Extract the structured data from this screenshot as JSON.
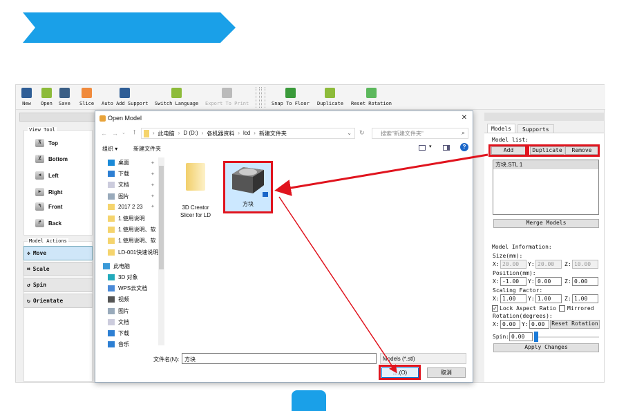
{
  "colors": {
    "accent": "#1aa0e8",
    "highlight": "#e0141e"
  },
  "toolbar": [
    {
      "label": "New",
      "icon": "new-icon",
      "color": "#2f5e96"
    },
    {
      "label": "Open",
      "icon": "open-icon",
      "color": "#8dbb3a"
    },
    {
      "label": "Save",
      "icon": "save-icon",
      "color": "#3b5f86"
    },
    {
      "label": "Slice",
      "icon": "slice-icon",
      "color": "#f08a3c"
    },
    {
      "label": "Auto Add Support",
      "icon": "support-icon",
      "color": "#2f5e96"
    },
    {
      "label": "Switch Language",
      "icon": "language-icon",
      "color": "#8dbb3a"
    },
    {
      "label": "Export To Print",
      "icon": "export-icon",
      "color": "#bbbbbb"
    },
    {
      "label": "Snap To Floor",
      "icon": "snap-floor-icon",
      "color": "#3a9a3a"
    },
    {
      "label": "Duplicate",
      "icon": "duplicate-icon",
      "color": "#8dbb3a"
    },
    {
      "label": "Reset Rotation",
      "icon": "reset-rotation-icon",
      "color": "#5cb85c"
    }
  ],
  "left": {
    "view_title": "View Tool",
    "views": [
      {
        "label": "Top",
        "glyph": "⊼"
      },
      {
        "label": "Bottom",
        "glyph": "⊻"
      },
      {
        "label": "Left",
        "glyph": "◂"
      },
      {
        "label": "Right",
        "glyph": "▸"
      },
      {
        "label": "Front",
        "glyph": "↰"
      },
      {
        "label": "Back",
        "glyph": "↱"
      }
    ],
    "actions_title": "Model Actions",
    "actions": [
      {
        "label": "Move",
        "glyph": "✥"
      },
      {
        "label": "Scale",
        "glyph": "⌗"
      },
      {
        "label": "Spin",
        "glyph": "↺"
      },
      {
        "label": "Orientate",
        "glyph": "↻"
      }
    ]
  },
  "dialog": {
    "title": "Open Model",
    "close": "✕",
    "breadcrumb": [
      "此电脑",
      "D (D:)",
      "各机器资料",
      "lcd",
      "新建文件夹"
    ],
    "search_placeholder": "搜索\"新建文件夹\"",
    "organize": "组织 ▾",
    "new_folder": "新建文件夹",
    "nav": [
      {
        "label": "桌面",
        "icon": "desktop-icon",
        "pinned": true
      },
      {
        "label": "下载",
        "icon": "download-icon",
        "pinned": true
      },
      {
        "label": "文档",
        "icon": "document-icon",
        "pinned": true
      },
      {
        "label": "图片",
        "icon": "pictures-icon",
        "pinned": true
      },
      {
        "label": "2017 2 23",
        "icon": "folder-icon",
        "pinned": true
      },
      {
        "label": "1.使用说明",
        "icon": "folder-icon"
      },
      {
        "label": "1.使用说明、软",
        "icon": "folder-icon"
      },
      {
        "label": "1.使用说明、软",
        "icon": "folder-icon"
      },
      {
        "label": "LD-001快速说明",
        "icon": "folder-icon"
      },
      {
        "label": "此电脑",
        "icon": "computer-icon",
        "top": true
      },
      {
        "label": "3D 对象",
        "icon": "3d-objects-icon"
      },
      {
        "label": "WPS云文档",
        "icon": "cloud-icon"
      },
      {
        "label": "视频",
        "icon": "video-icon"
      },
      {
        "label": "图片",
        "icon": "pictures-icon"
      },
      {
        "label": "文档",
        "icon": "document-icon"
      },
      {
        "label": "下载",
        "icon": "download-icon"
      },
      {
        "label": "音乐",
        "icon": "music-icon"
      }
    ],
    "files": [
      {
        "name": "3D Creator Slicer for LD",
        "type": "folder"
      },
      {
        "name": "方块",
        "type": "stl",
        "selected": true
      }
    ],
    "filename_label": "文件名(N):",
    "filename_value": "方块",
    "filetype": "Models (*.stl)",
    "open_label": "....(O)",
    "cancel_label": "取消"
  },
  "right": {
    "tabs": [
      "Models",
      "Supports"
    ],
    "model_list_title": "Model list:",
    "add": "Add",
    "duplicate": "Duplicate",
    "remove": "Remove",
    "models": [
      "方块.STL 1"
    ],
    "merge": "Merge Models",
    "info_title": "Model Information:",
    "size_label": "Size(mm):",
    "size": [
      "20.00",
      "20.00",
      "10.00"
    ],
    "position_label": "Position(mm):",
    "position": [
      "-1.00",
      "0.00",
      "0.00"
    ],
    "scale_label": "Scaling Factor:",
    "scale": [
      "1.00",
      "1.00",
      "1.00"
    ],
    "lock_aspect": "Lock Aspect Ratio",
    "lock_checked": true,
    "mirrored": "Mirrored",
    "mirrored_checked": false,
    "rotation_label": "Rotation(degrees):",
    "rotation": [
      "0.00",
      "0.00"
    ],
    "reset_rotation": "Reset Rotation",
    "spin_label": "Spin:",
    "spin": "0.00",
    "spin_slider": 0,
    "apply": "Apply Changes",
    "axes": [
      "X:",
      "Y:",
      "Z:"
    ]
  }
}
